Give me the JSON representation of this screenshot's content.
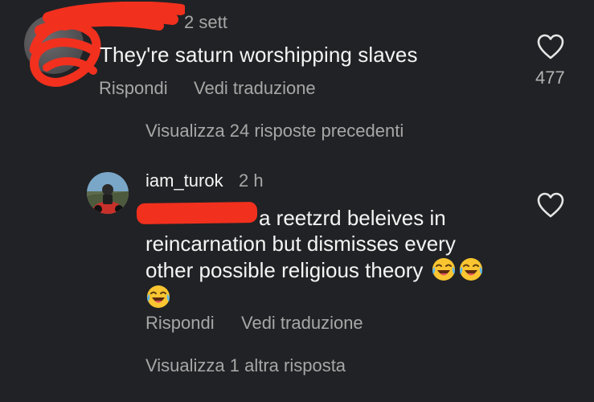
{
  "comment_1": {
    "time": "2 sett",
    "text": "They're saturn worshipping slaves",
    "reply_label": "Rispondi",
    "translate_label": "Vedi traduzione",
    "like_count": "477"
  },
  "view_previous_label": "Visualizza 24 risposte precedenti",
  "comment_2": {
    "username": "iam_turok",
    "time": "2 h",
    "text_line_1": "a reetzrd beleives in",
    "text_line_2": "reincarnation but dismisses every",
    "text_line_3": "other possible religious theory",
    "reply_label": "Rispondi",
    "translate_label": "Vedi traduzione"
  },
  "view_more_label": "Visualizza 1 altra risposta",
  "icons": {
    "like": "heart-outline-icon",
    "emoji": "face-with-tears-of-joy"
  },
  "colors": {
    "background": "#212225",
    "primary_text": "#f5f5f5",
    "secondary_text": "#a7a7a7",
    "redaction": "#f2301e"
  }
}
